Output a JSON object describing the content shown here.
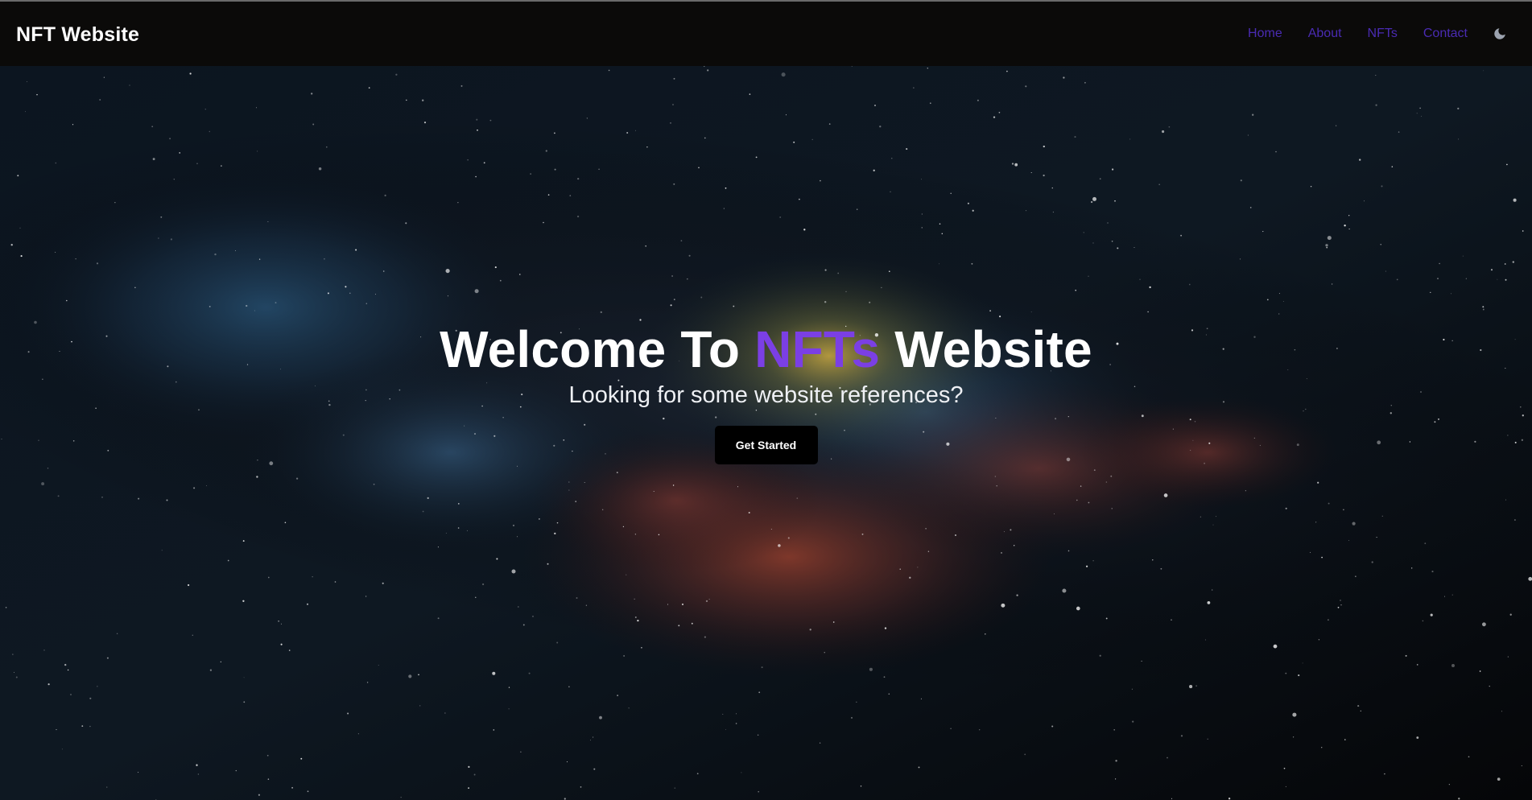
{
  "navbar": {
    "brand": "NFT Website",
    "links": [
      {
        "label": "Home"
      },
      {
        "label": "About"
      },
      {
        "label": "NFTs"
      },
      {
        "label": "Contact"
      }
    ],
    "theme_toggle_icon": "moon-icon"
  },
  "hero": {
    "title_prefix": "Welcome To ",
    "title_accent": "NFTs",
    "title_suffix": " Website",
    "subtitle": "Looking for some website references?",
    "cta_label": "Get Started",
    "background": "starry-night-sky-image"
  },
  "colors": {
    "navbar_bg": "#0b0a09",
    "nav_link": "#4a2bb3",
    "accent": "#7b3fe4",
    "button_bg": "#000000",
    "text": "#ffffff"
  }
}
